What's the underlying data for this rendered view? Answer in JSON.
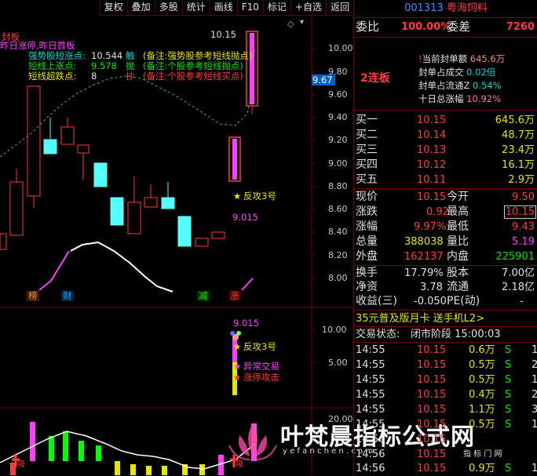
{
  "toolbar": {
    "items": [
      "复权",
      "叠加",
      "多股",
      "统计",
      "画线",
      "F10",
      "标记",
      "+自选",
      "返回"
    ],
    "icons": [
      "diamond-icon",
      "dropdown-icon"
    ]
  },
  "main_chart": {
    "top_left_text": "昨日涨停,昨日首板",
    "top_left_overlay": "封板",
    "legend": [
      {
        "name": "强势股短涨点:",
        "value": "10.544",
        "flag": "触",
        "note": "(备注:强势股参考短线抛点)",
        "note_color": "#e6e600"
      },
      {
        "name": "短线上涨点:",
        "value": "9.578",
        "flag": "抛",
        "note": "(备注:个股参考短线抛点)",
        "note_color": "#00e600"
      },
      {
        "name": "短线超跌点:",
        "value": "8",
        "flag": "抄",
        "note": "(备注:个股参考短线买点)",
        "note_color": "#ff3c3c"
      }
    ],
    "high_label": "10.15",
    "current_price_tag": "9.67",
    "yaxis": [
      "10.00",
      "9.80",
      "9.60",
      "9.40",
      "9.20",
      "9.00",
      "8.80",
      "8.60",
      "8.40",
      "8.20",
      "8.00"
    ],
    "annotations": {
      "fan_gong": "反攻3号",
      "price_9015": "9.015"
    },
    "bottom_markers": [
      "榜",
      "财",
      "减",
      "涨"
    ]
  },
  "sub_chart": {
    "yaxis": [
      "10.00",
      "5.00"
    ],
    "price_label": "9.015",
    "annotations": [
      "反攻3号",
      "异常交易",
      "涨停攻击"
    ]
  },
  "vol_chart": {
    "ytick": "20.00",
    "flag_text": "吸"
  },
  "watermark": {
    "main": "叶梵晨指标公式网",
    "url": "y e f a n c h e n . c o m",
    "sub": "指 标 门 网"
  },
  "panel": {
    "code": "001313",
    "name": "粤海饲料",
    "weibi_label": "委比",
    "weibi_value": "100.00%",
    "weicha_label": "委差",
    "weicha_value": "7260",
    "board_tag": "2连板",
    "seal_info": [
      {
        "label": "当前封单额",
        "value": "645.6万"
      },
      {
        "label": "封单占成交",
        "value": "0.02倍"
      },
      {
        "label": "封单占流通Z",
        "value": "0.54%"
      },
      {
        "label": "十日总涨幅",
        "value": "10.92%"
      }
    ],
    "buys": [
      {
        "label": "买一",
        "price": "10.15",
        "vol": "645.6万"
      },
      {
        "label": "买二",
        "price": "10.14",
        "vol": "48.7万"
      },
      {
        "label": "买三",
        "price": "10.13",
        "vol": "23.4万"
      },
      {
        "label": "买四",
        "price": "10.12",
        "vol": "16.1万"
      },
      {
        "label": "买五",
        "price": "10.11",
        "vol": "2.9万"
      }
    ],
    "quote": [
      {
        "l1": "现价",
        "v1": "10.15",
        "l2": "今开",
        "v2": "9.50"
      },
      {
        "l1": "涨跌",
        "v1": "0.92",
        "l2": "最高",
        "v2": "10.15"
      },
      {
        "l1": "涨幅",
        "v1": "9.97%",
        "l2": "最低",
        "v2": "9.43"
      },
      {
        "l1": "总量",
        "v1": "388038",
        "l2": "量比",
        "v2": "5.19"
      },
      {
        "l1": "外盘",
        "v1": "162137",
        "l2": "内盘",
        "v2": "225901"
      }
    ],
    "stats": [
      {
        "l1": "换手",
        "v1": "17.79%",
        "l2": "股本",
        "v2": "7.00亿"
      },
      {
        "l1": "净资",
        "v1": "3.78",
        "l2": "流通",
        "v2": "2.18亿"
      },
      {
        "l1": "收益(三)",
        "v1": "-0.050",
        "l2": "PE(动)",
        "v2": "-"
      }
    ],
    "promo": "35元普及版月卡 送手机L2>",
    "trade_status_label": "交易状态:",
    "trade_status_value": "闭市阶段 15:00:03",
    "ticks": [
      {
        "time": "14:55",
        "price": "10.15",
        "vol": "0.6万",
        "side": "S",
        "n": "1"
      },
      {
        "time": "14:55",
        "price": "10.15",
        "vol": "0.5万",
        "side": "S",
        "n": "2"
      },
      {
        "time": "14:55",
        "price": "10.15",
        "vol": "0.5万",
        "side": "S",
        "n": "1"
      },
      {
        "time": "14:55",
        "price": "10.15",
        "vol": "0.4万",
        "side": "S",
        "n": "2"
      },
      {
        "time": "14:55",
        "price": "10.15",
        "vol": "1.1万",
        "side": "S",
        "n": "3"
      },
      {
        "time": "14:55",
        "price": "10.15",
        "vol": "0.5万",
        "side": "S",
        "n": "1"
      },
      {
        "time": "14:56",
        "price": "10.15",
        "vol": "",
        "side": "",
        "n": ""
      },
      {
        "time": "14:56",
        "price": "10.15",
        "vol": "",
        "side": "",
        "n": ""
      },
      {
        "time": "14:56",
        "price": "10.15",
        "vol": "0.9万",
        "side": "S",
        "n": "1"
      }
    ]
  }
}
